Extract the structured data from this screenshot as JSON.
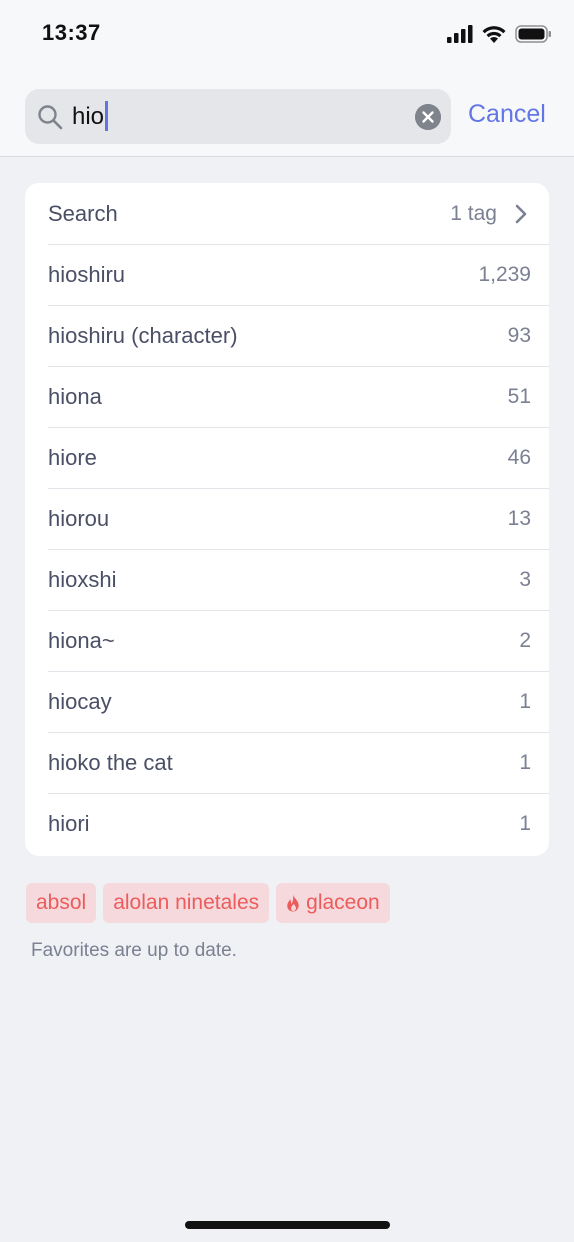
{
  "status_bar": {
    "time": "13:37"
  },
  "search": {
    "query": "hio",
    "cancel_label": "Cancel"
  },
  "results": {
    "search_row": {
      "label": "Search",
      "count": "1 tag"
    },
    "items": [
      {
        "name": "hioshiru",
        "count": "1,239"
      },
      {
        "name": "hioshiru (character)",
        "count": "93"
      },
      {
        "name": "hiona",
        "count": "51"
      },
      {
        "name": "hiore",
        "count": "46"
      },
      {
        "name": "hiorou",
        "count": "13"
      },
      {
        "name": "hioxshi",
        "count": "3"
      },
      {
        "name": "hiona~",
        "count": "2"
      },
      {
        "name": "hiocay",
        "count": "1"
      },
      {
        "name": "hioko the cat",
        "count": "1"
      },
      {
        "name": "hiori",
        "count": "1"
      }
    ]
  },
  "favorites": {
    "chips": [
      {
        "label": "absol",
        "icon": ""
      },
      {
        "label": "alolan ninetales",
        "icon": ""
      },
      {
        "label": "glaceon",
        "icon": "flame-icon"
      }
    ],
    "status": "Favorites are up to date."
  },
  "colors": {
    "accent": "#6376e6",
    "chip_bg": "#f6d9dc",
    "chip_text": "#ec5c5c",
    "background": "#f0f1f4"
  }
}
